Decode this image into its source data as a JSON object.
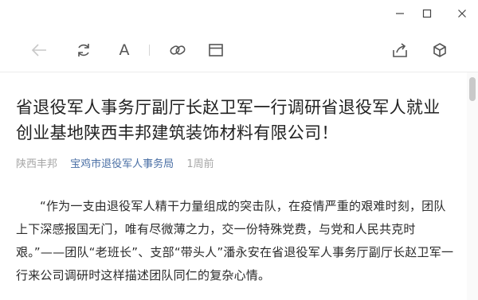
{
  "window": {
    "icons": [
      "minimize-icon",
      "maximize-icon",
      "close-icon"
    ]
  },
  "toolbar": {
    "font_label": "A",
    "icons": [
      "back-icon",
      "refresh-icon",
      "font-size-icon",
      "link-icon",
      "reader-icon",
      "share-icon",
      "cube-icon"
    ]
  },
  "article": {
    "title": "省退役军人事务厅副厅长赵卫军一行调研省退役军人就业创业基地陕西丰邦建筑装饰材料有限公司！",
    "author": "陕西丰邦",
    "account": "宝鸡市退役军人事务局",
    "time": "1周前",
    "body": "“作为一支由退役军人精干力量组成的突击队，在疫情严重的艰难时刻，团队上下深感报国无门，唯有尽微薄之力，交一份特殊党费，与党和人民共克时艰。”——团队“老班长”、支部“带头人”潘永安在省退役军人事务厅副厅长赵卫军一行来公司调研时这样描述团队同仁的复杂心情。"
  },
  "colors": {
    "account_link": "#4a6fa5",
    "meta_gray": "#a6a6a6",
    "icon_gray": "#555555",
    "icon_disabled": "#c8c8c8"
  }
}
